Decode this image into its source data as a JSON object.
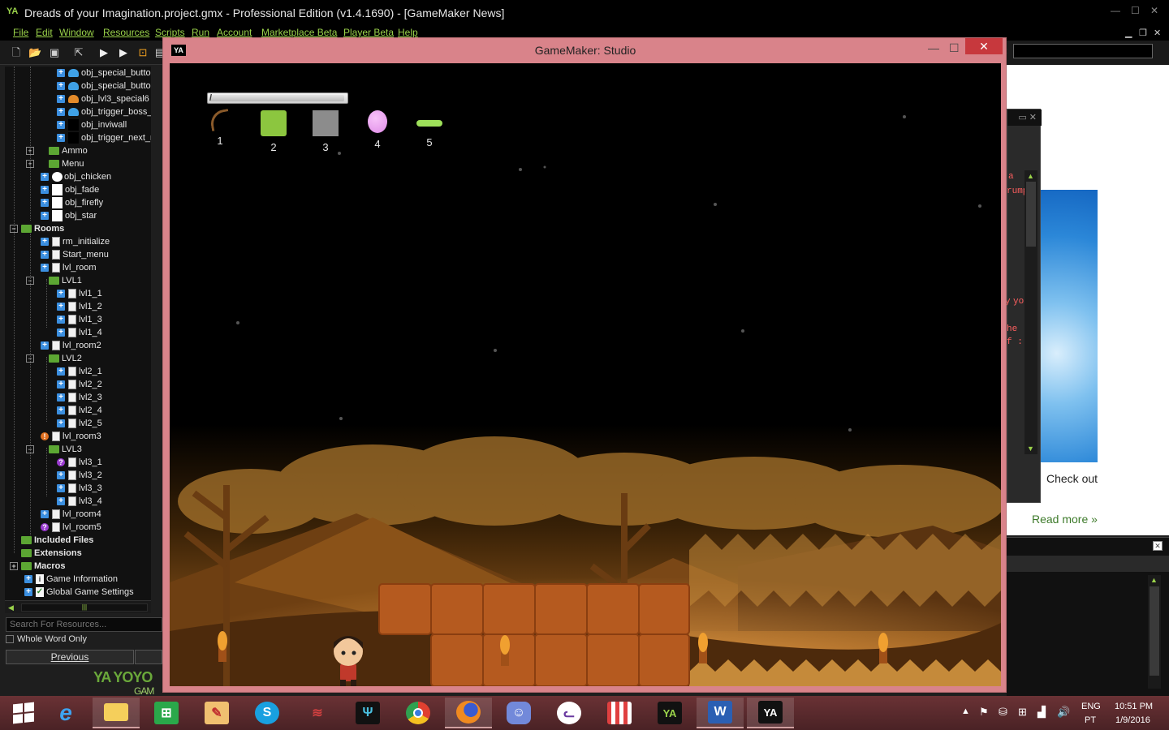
{
  "ide": {
    "title": "Dreads of your Imagination.project.gmx  -  Professional Edition (v1.4.1690)   - [GameMaker News]",
    "menu": [
      "File",
      "Edit",
      "Window",
      "Resources",
      "Scripts",
      "Run",
      "Account",
      "Marketplace Beta",
      "Player Beta",
      "Help"
    ],
    "window_controls": [
      "minimize",
      "maximize",
      "close"
    ]
  },
  "resource_tree": [
    {
      "label": "obj_special_button_l",
      "icon": "sprite-blue"
    },
    {
      "label": "obj_special_button_l",
      "icon": "sprite-blue"
    },
    {
      "label": "obj_lvl3_special6",
      "icon": "sprite-orange"
    },
    {
      "label": "obj_trigger_boss_l",
      "icon": "sprite-blue"
    },
    {
      "label": "obj_inviwall",
      "icon": "blank-dark"
    },
    {
      "label": "obj_trigger_next_r",
      "icon": "blank-dark"
    },
    {
      "label": "Ammo",
      "icon": "folder"
    },
    {
      "label": "Menu",
      "icon": "folder"
    },
    {
      "label": "obj_chicken",
      "icon": "chicken"
    },
    {
      "label": "obj_fade",
      "icon": "blank"
    },
    {
      "label": "obj_firefly",
      "icon": "blank"
    },
    {
      "label": "obj_star",
      "icon": "blank"
    },
    {
      "label": "Rooms",
      "icon": "folder"
    },
    {
      "label": "rm_initialize",
      "icon": "doc"
    },
    {
      "label": "Start_menu",
      "icon": "doc"
    },
    {
      "label": "lvl_room",
      "icon": "doc"
    },
    {
      "label": "LVL1",
      "icon": "folder"
    },
    {
      "label": "lvl1_1",
      "icon": "doc"
    },
    {
      "label": "lvl1_2",
      "icon": "doc"
    },
    {
      "label": "lvl1_3",
      "icon": "doc"
    },
    {
      "label": "lvl1_4",
      "icon": "doc"
    },
    {
      "label": "lvl_room2",
      "icon": "doc"
    },
    {
      "label": "LVL2",
      "icon": "folder"
    },
    {
      "label": "lvl2_1",
      "icon": "doc"
    },
    {
      "label": "lvl2_2",
      "icon": "doc"
    },
    {
      "label": "lvl2_3",
      "icon": "doc"
    },
    {
      "label": "lvl2_4",
      "icon": "doc"
    },
    {
      "label": "lvl2_5",
      "icon": "doc"
    },
    {
      "label": "lvl_room3",
      "icon": "doc"
    },
    {
      "label": "LVL3",
      "icon": "folder"
    },
    {
      "label": "lvl3_1",
      "icon": "doc"
    },
    {
      "label": "lvl3_2",
      "icon": "doc"
    },
    {
      "label": "lvl3_3",
      "icon": "doc"
    },
    {
      "label": "lvl3_4",
      "icon": "doc"
    },
    {
      "label": "lvl_room4",
      "icon": "doc"
    },
    {
      "label": "lvl_room5",
      "icon": "doc"
    },
    {
      "label": "Included Files",
      "icon": "folder"
    },
    {
      "label": "Extensions",
      "icon": "folder"
    },
    {
      "label": "Macros",
      "icon": "folder"
    },
    {
      "label": "Game Information",
      "icon": "info"
    },
    {
      "label": "Global Game Settings",
      "icon": "check"
    }
  ],
  "search": {
    "placeholder": "Search For Resources...",
    "whole_word": "Whole Word Only",
    "previous": "Previous"
  },
  "yoyo_logo": {
    "main": "YOYO",
    "sub": "GAM"
  },
  "news": {
    "check_out": "Check out",
    "read_more": "Read more »"
  },
  "code_fragments": [
    "a",
    "rump",
    "y",
    "yo",
    "he",
    "f :"
  ],
  "game_window": {
    "title": "GameMaker: Studio",
    "close_label": "✕",
    "hud": {
      "bar_fraction": 0.99,
      "slots": [
        {
          "number": "1",
          "item": "bow-icon",
          "color": "#8a5a2a"
        },
        {
          "number": "2",
          "item": "green-block-icon",
          "color": "#8cc63f"
        },
        {
          "number": "3",
          "item": "gray-block-icon",
          "color": "#8c8c8c"
        },
        {
          "number": "4",
          "item": "pink-egg-icon",
          "color": "#e08ce8"
        },
        {
          "number": "5",
          "item": "green-bar-icon",
          "color": "#9ee05a"
        }
      ]
    }
  },
  "taskbar": {
    "lang": "ENG",
    "region": "PT",
    "time": "10:51 PM",
    "date": "1/9/2016",
    "apps": [
      "windows-start",
      "internet-explorer",
      "file-explorer",
      "store",
      "paint",
      "skype",
      "rog",
      "steelseries",
      "chrome",
      "firefox",
      "discord",
      "pokerstars",
      "popcorn",
      "gamemaker",
      "word",
      "gamemaker-runner"
    ]
  },
  "colors": {
    "accent": "#9ad24a",
    "game_frame": "#d9838a",
    "taskbar": "#5a2a2d"
  }
}
